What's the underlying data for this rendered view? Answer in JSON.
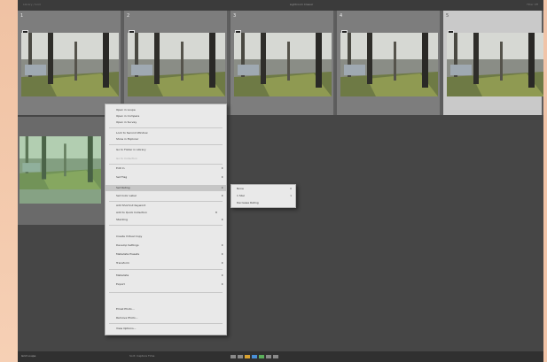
{
  "window": {
    "title": "Lightroom Classic",
    "left_info": "Library / Grid",
    "right_info": "Filter Off"
  },
  "filmstrip": {
    "cells": [
      {
        "number": "1",
        "selected": false
      },
      {
        "number": "2",
        "selected": false
      },
      {
        "number": "3",
        "selected": false
      },
      {
        "number": "4",
        "selected": false
      },
      {
        "number": "5",
        "selected": true
      }
    ],
    "second_row_cell": {
      "number": "6",
      "tint_color": "#78be78"
    }
  },
  "context_menu": {
    "items": [
      {
        "label": "Open in Loupe",
        "dim": false
      },
      {
        "label": "Open in Compare",
        "dim": false
      },
      {
        "label": "Open in Survey",
        "dim": false
      },
      {
        "label": "Lock to Second Window",
        "dim": false
      },
      {
        "label": "Show in Explorer",
        "dim": false
      },
      {
        "label": "Go to Folder in Library",
        "dim": false
      },
      {
        "label": "Go to Collection",
        "dim": true
      },
      {
        "label": "Edit In",
        "dim": false,
        "submenu": true
      },
      {
        "label": "Set Flag",
        "dim": false,
        "submenu": true
      },
      {
        "label": "Set Rating",
        "dim": false,
        "submenu": true,
        "highlight": true
      },
      {
        "label": "Set Color Label",
        "dim": false,
        "submenu": true
      },
      {
        "label": "Add Shortcut Keyword",
        "dim": false
      },
      {
        "label": "Add to Quick Collection",
        "dim": false,
        "shortcut": "B"
      },
      {
        "label": "Stacking",
        "dim": false,
        "submenu": true
      },
      {
        "label": "Create Virtual Copy",
        "dim": false
      },
      {
        "label": "Develop Settings",
        "dim": false,
        "submenu": true
      },
      {
        "label": "Metadata Presets",
        "dim": false,
        "submenu": true
      },
      {
        "label": "Transform",
        "dim": false,
        "submenu": true
      },
      {
        "label": "Metadata",
        "dim": false,
        "submenu": true
      },
      {
        "label": "Export",
        "dim": false,
        "submenu": true
      },
      {
        "label": "Email Photo...",
        "dim": false
      },
      {
        "label": "Remove Photo...",
        "dim": false
      },
      {
        "label": "View Options...",
        "dim": false
      }
    ]
  },
  "submenu": {
    "items": [
      {
        "label": "None",
        "shortcut": "0"
      },
      {
        "label": "1 Star",
        "shortcut": "1"
      },
      {
        "label": "Decrease Rating",
        "shortcut": ""
      }
    ]
  },
  "bottombar": {
    "left_text": "Grid  Loupe",
    "mid_text": "Sort: Capture Time",
    "label_colors": [
      "#d9a230",
      "#4a8fd8",
      "#5bb05b"
    ]
  }
}
